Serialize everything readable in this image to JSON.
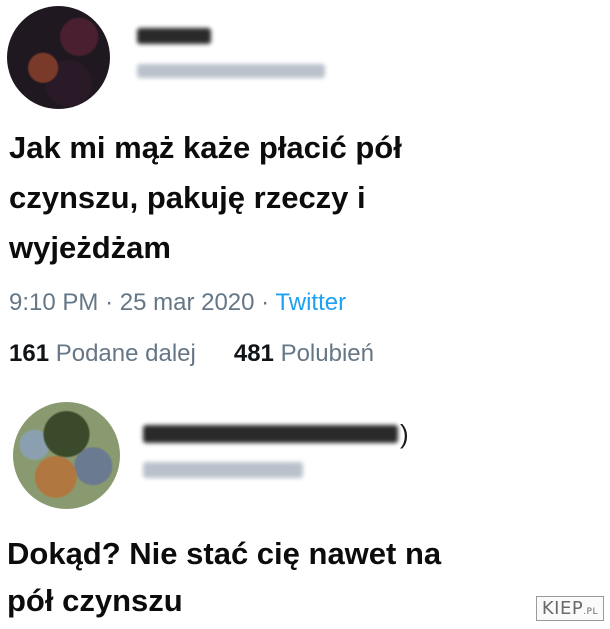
{
  "tweet": {
    "text_line1": "Jak mi mąż każe płacić pół",
    "text_line2": "czynszu, pakuję rzeczy i",
    "text_line3": "wyjeżdżam",
    "time": "9:10 PM",
    "separator": "·",
    "date": "25 mar 2020",
    "source": "Twitter",
    "retweets_count": "161",
    "retweets_label": "Podane dalej",
    "likes_count": "481",
    "likes_label": "Polubień"
  },
  "reply": {
    "name_suffix": ")",
    "text_line1": "Dokąd? Nie stać cię nawet na",
    "text_line2": "pół czynszu"
  },
  "watermark": {
    "main": "KIEP",
    "suffix": ".PL"
  },
  "colors": {
    "meta_gray": "#657786",
    "twitter_blue": "#1da1f2",
    "text": "#0c0c0c"
  }
}
